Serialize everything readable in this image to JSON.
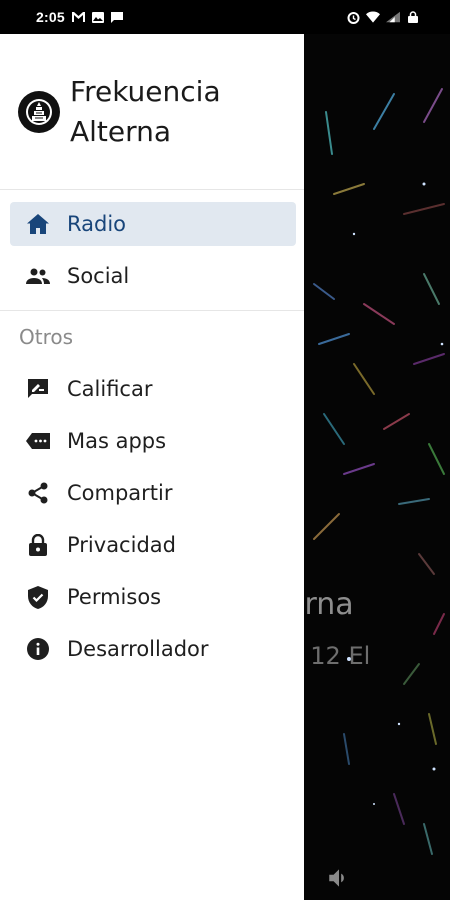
{
  "status_bar": {
    "time": "2:05",
    "left_icons": [
      "gmail-icon",
      "gallery-icon",
      "message-icon"
    ],
    "right_icons": [
      "alarm-icon",
      "wifi-icon",
      "signal-icon",
      "lock-icon"
    ]
  },
  "drawer": {
    "app_title": "Frekuencia Alterna",
    "logo_icon": "radio-tower-logo-icon",
    "main_items": [
      {
        "label": "Radio",
        "icon": "home-icon",
        "active": true
      },
      {
        "label": "Social",
        "icon": "people-icon",
        "active": false
      }
    ],
    "section_title": "Otros",
    "other_items": [
      {
        "label": "Calificar",
        "icon": "rate-review-icon"
      },
      {
        "label": "Mas apps",
        "icon": "shop-tag-icon"
      },
      {
        "label": "Compartir",
        "icon": "share-icon"
      },
      {
        "label": "Privacidad",
        "icon": "lock-icon"
      },
      {
        "label": "Permisos",
        "icon": "verified-shield-icon"
      },
      {
        "label": "Desarrollador",
        "icon": "info-icon"
      }
    ]
  },
  "player": {
    "title_fragment": "erna",
    "subtitle_fragment": "- 12 El",
    "volume_icon": "volume-icon"
  },
  "colors": {
    "active_background": "#e1e8f0",
    "active_text": "#18457a",
    "player_background": "#050505"
  }
}
